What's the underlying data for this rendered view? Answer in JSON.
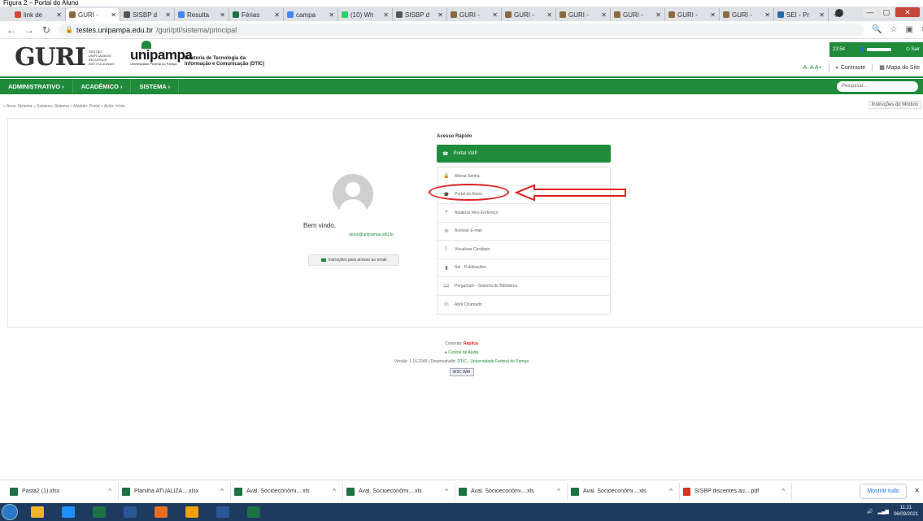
{
  "caption": "Figura 2 – Portal do Aluno",
  "browser": {
    "tabs": [
      {
        "title": "link de",
        "fav": "#d44638"
      },
      {
        "title": "GURI -",
        "fav": "#8b6a3e",
        "active": true
      },
      {
        "title": "SISBP d",
        "fav": "#555"
      },
      {
        "title": "Resulta",
        "fav": "#4285f4"
      },
      {
        "title": "Férias",
        "fav": "#1e7145"
      },
      {
        "title": "campa",
        "fav": "#4285f4"
      },
      {
        "title": "(10) Wh",
        "fav": "#25d366"
      },
      {
        "title": "SISBP d",
        "fav": "#555"
      },
      {
        "title": "GURI -",
        "fav": "#8b6a3e"
      },
      {
        "title": "GURI -",
        "fav": "#8b6a3e"
      },
      {
        "title": "GURI -",
        "fav": "#8b6a3e"
      },
      {
        "title": "GURI -",
        "fav": "#8b6a3e"
      },
      {
        "title": "GURI -",
        "fav": "#8b6a3e"
      },
      {
        "title": "GURI -",
        "fav": "#8b6a3e"
      },
      {
        "title": "SEI - Pr",
        "fav": "#2a6aa8"
      }
    ],
    "url_host": "testes.unipampa.edu.br",
    "url_path": "/guri/ptl/sistema/principal",
    "profile_initial": "V"
  },
  "header": {
    "guri": "GURI",
    "guri_sub": "GESTÃO UNIFICADA DE RECURSOS INSTITUCIONAIS",
    "unipampa": "unipampa",
    "unipampa_sub": "Universidade Federal do Pampa",
    "dtic_line1": "Diretoria de Tecnologia da",
    "dtic_line2": "Informação e Comunicação (DTIC)",
    "time": "23:54",
    "sair": "Sair",
    "font_small": "A-",
    "font_normal": "A",
    "font_large": "A+",
    "contraste": "Contraste",
    "mapa": "Mapa do Site"
  },
  "menu": {
    "items": [
      "ADMINISTRATIVO ›",
      "ACADÊMICO ›",
      "SISTEMA ›"
    ],
    "search_placeholder": "Pesquisar..."
  },
  "breadcrumb": "» Área: Sistema » Subárea: Sistema » Módulo: Portal » Ação: Início",
  "instrucoes_modulo": "Instruções do Módulo",
  "user": {
    "welcome": "Bem vindo,",
    "email": "aluno@unipampa.edu.br",
    "email_instr": "Instruções para acesso ao email"
  },
  "quick": {
    "title": "Acesso Rápido",
    "voip": "Portal VoIP",
    "items": [
      {
        "label": "Alterar Senha",
        "icon": "lock-icon",
        "glyph": "🔒"
      },
      {
        "label": "Portal do Aluno",
        "icon": "student-icon",
        "glyph": "🎓"
      },
      {
        "label": "Atualizar Meu Endereço",
        "icon": "location-icon",
        "glyph": "⌖"
      },
      {
        "label": "Acessar E-mail",
        "icon": "email-icon",
        "glyph": "✉"
      },
      {
        "label": "Visualizar Cardápio",
        "icon": "cutlery-icon",
        "glyph": "🍴"
      },
      {
        "label": "Sei - Publicações",
        "icon": "chart-icon",
        "glyph": "▮"
      },
      {
        "label": "Pergamum - Sistema de Biblioteca",
        "icon": "book-icon",
        "glyph": "📖"
      },
      {
        "label": "Abrir Chamado",
        "icon": "support-icon",
        "glyph": "☏"
      }
    ]
  },
  "footer": {
    "conexao": "Conexão:",
    "replica": "Réplica",
    "ajuda": "Central de Ajuda",
    "versao": "Versão: 1.16.2045 | Desenvolvido:",
    "dev": "DTIC - Universidade Federal do Pampa",
    "w3c": "W3C WAI"
  },
  "downloads": {
    "items": [
      {
        "name": "Pasta2 (1).xlsx",
        "type": "xl"
      },
      {
        "name": "Planilha ATUALIZA....xlsx",
        "type": "xl"
      },
      {
        "name": "Aval. Socioeconômi....xls",
        "type": "xl"
      },
      {
        "name": "Aval. Socioeconômi....xls",
        "type": "xl"
      },
      {
        "name": "Aval. Socioeconômi....xls",
        "type": "xl"
      },
      {
        "name": "Aval. Socioeconômi....xls",
        "type": "xl"
      },
      {
        "name": "SISBP discentes au....pdf",
        "type": "pdf"
      }
    ],
    "show_all": "Mostrar tudo"
  },
  "taskbar": {
    "time": "11:21",
    "date": "06/09/2021",
    "apps": [
      "#f0b429",
      "#1e90ff",
      "#1e7145",
      "#2b5797",
      "#e86e1f",
      "#f0a000",
      "#2b579a",
      "#1e7145"
    ]
  }
}
